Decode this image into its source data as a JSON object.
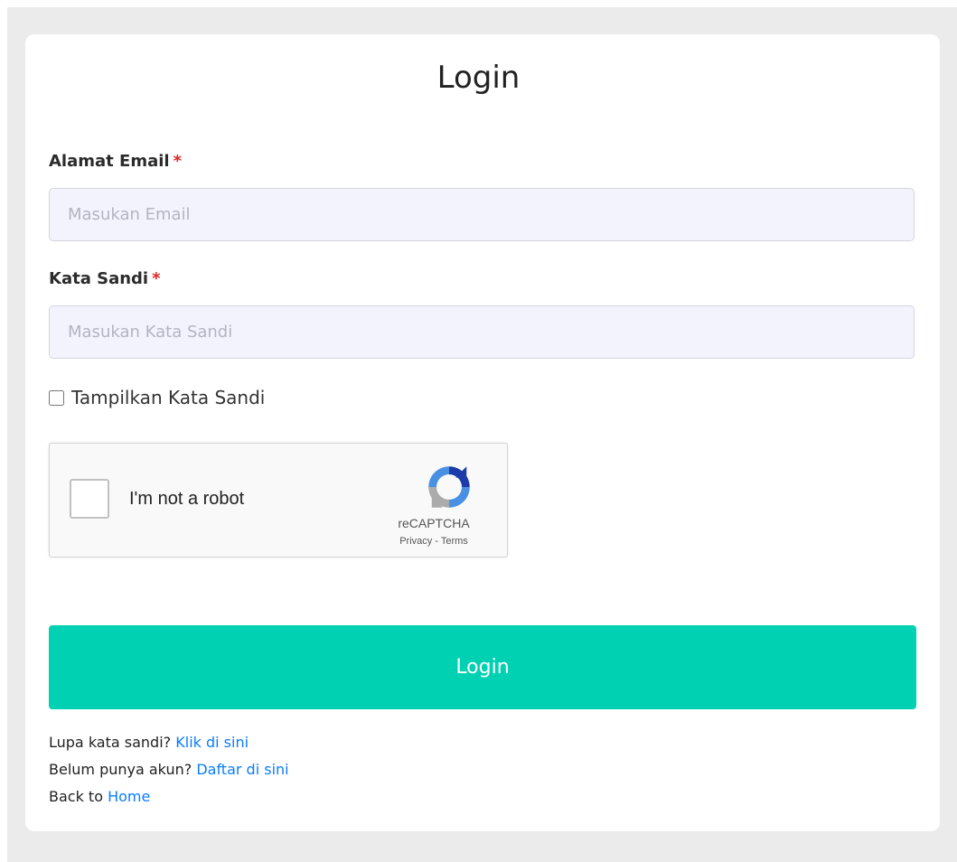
{
  "form": {
    "title": "Login",
    "email_label": "Alamat Email",
    "email_placeholder": "Masukan Email",
    "password_label": "Kata Sandi",
    "password_placeholder": "Masukan Kata Sandi",
    "required_mark": "*",
    "show_password_label": "Tampilkan Kata Sandi",
    "submit_label": "Login"
  },
  "captcha": {
    "label": "I'm not a robot",
    "brand": "reCAPTCHA",
    "privacy": "Privacy",
    "separator": "-",
    "terms": "Terms"
  },
  "links": {
    "forgot_prefix": "Lupa kata sandi?",
    "forgot_link": "Klik di sini",
    "register_prefix": "Belum punya akun?",
    "register_link": "Daftar di sini",
    "home_prefix": "Back to",
    "home_link": "Home"
  },
  "colors": {
    "accent": "#00d1b2",
    "link": "#0a7cff",
    "required": "#e02424"
  }
}
